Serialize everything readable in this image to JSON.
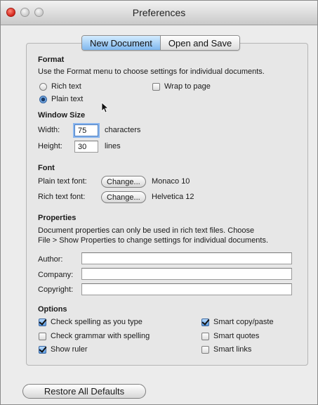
{
  "window": {
    "title": "Preferences"
  },
  "tabs": {
    "new_document": "New Document",
    "open_and_save": "Open and Save"
  },
  "format": {
    "header": "Format",
    "description": "Use the Format menu to choose settings for individual documents.",
    "rich_text": "Rich text",
    "plain_text": "Plain text",
    "selected": "Plain text",
    "wrap_to_page": "Wrap to page",
    "wrap_checked": false
  },
  "window_size": {
    "header": "Window Size",
    "width_label": "Width:",
    "width_value": "75",
    "width_unit": "characters",
    "height_label": "Height:",
    "height_value": "30",
    "height_unit": "lines"
  },
  "font": {
    "header": "Font",
    "plain_label": "Plain text font:",
    "plain_button": "Change...",
    "plain_value": "Monaco 10",
    "rich_label": "Rich text font:",
    "rich_button": "Change...",
    "rich_value": "Helvetica 12"
  },
  "properties": {
    "header": "Properties",
    "description_line1": "Document properties can only be used in rich text files. Choose",
    "description_line2": "File > Show Properties to change settings for individual documents.",
    "author_label": "Author:",
    "company_label": "Company:",
    "copyright_label": "Copyright:",
    "author_value": "",
    "company_value": "",
    "copyright_value": ""
  },
  "options": {
    "header": "Options",
    "check_spelling": "Check spelling as you type",
    "check_grammar": "Check grammar with spelling",
    "show_ruler": "Show ruler",
    "smart_copy_paste": "Smart copy/paste",
    "smart_quotes": "Smart quotes",
    "smart_links": "Smart links",
    "checked": {
      "check_spelling": true,
      "check_grammar": false,
      "show_ruler": true,
      "smart_copy_paste": true,
      "smart_quotes": false,
      "smart_links": false
    }
  },
  "restore_button": "Restore All Defaults",
  "colors": {
    "accent": "#7fb7ee",
    "window_bg": "#ececec"
  },
  "icons": {
    "close": "close-icon",
    "minimize": "minimize-icon",
    "zoom": "zoom-icon",
    "cursor": "arrow-cursor-icon"
  }
}
